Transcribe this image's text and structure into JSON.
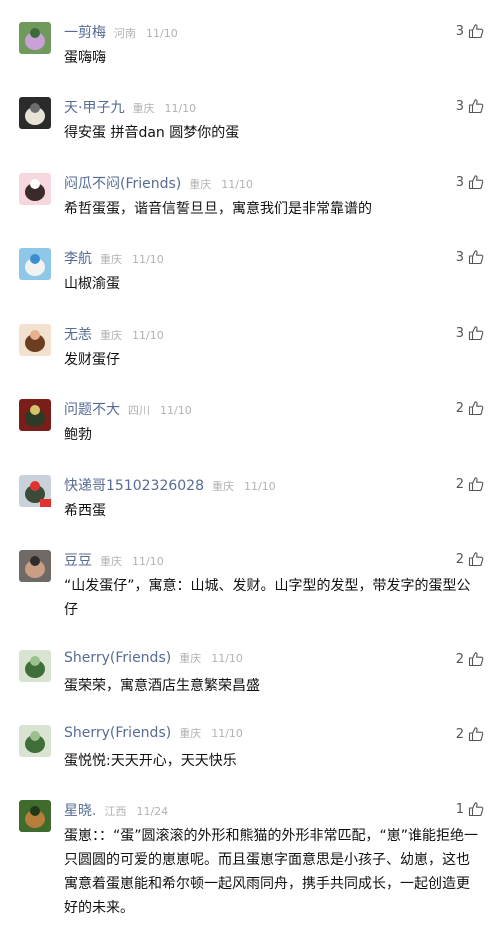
{
  "comments": [
    {
      "name": "一剪梅",
      "location": "河南",
      "date": "11/10",
      "likes": "3",
      "text": "蛋嗨嗨",
      "avatar": "avatar-garden",
      "colors": [
        "#6f9a5c",
        "#c9a1d6",
        "#3e6b3a"
      ]
    },
    {
      "name": "天·甲子九",
      "location": "重庆",
      "date": "11/10",
      "likes": "3",
      "text": "得安蛋 拼音dan 圆梦你的蛋",
      "avatar": "avatar-cats-dark",
      "colors": [
        "#2b2b2b",
        "#e8e2d8",
        "#6d6d6d"
      ]
    },
    {
      "name": "闷瓜不闷(Friends)",
      "location": "重庆",
      "date": "11/10",
      "likes": "3",
      "text": "希哲蛋蛋，谐音信誓旦旦，寓意我们是非常靠谱的",
      "avatar": "avatar-cartoon-girl",
      "colors": [
        "#f6d7dd",
        "#3b2a2a",
        "#ffffff"
      ]
    },
    {
      "name": "李航",
      "location": "重庆",
      "date": "11/10",
      "likes": "3",
      "text": "山椒渝蛋",
      "avatar": "avatar-white-bunny",
      "colors": [
        "#8fc7e8",
        "#f2f2f2",
        "#3a8fd0"
      ]
    },
    {
      "name": "无恙",
      "location": "重庆",
      "date": "11/10",
      "likes": "3",
      "text": "发财蛋仔",
      "avatar": "avatar-child-portrait",
      "colors": [
        "#f2e1cf",
        "#6a3e1f",
        "#e8b08f"
      ]
    },
    {
      "name": "问题不大",
      "location": "四川",
      "date": "11/10",
      "likes": "2",
      "text": "鲍勃",
      "avatar": "avatar-dark-character",
      "colors": [
        "#7a1e1a",
        "#2c3b25",
        "#d8c36a"
      ]
    },
    {
      "name": "快递哥15102326028",
      "location": "重庆",
      "date": "11/10",
      "likes": "2",
      "text": "希西蛋",
      "avatar": "avatar-landscape-flag",
      "colors": [
        "#c9d2da",
        "#3c4a3a",
        "#e0332f"
      ]
    },
    {
      "name": "豆豆",
      "location": "重庆",
      "date": "11/10",
      "likes": "2",
      "text": "“山发蛋仔”，寓意：山城、发财。山字型的发型，带发字的蛋型公仔",
      "avatar": "avatar-man-photo",
      "colors": [
        "#6f6a66",
        "#c89f85",
        "#2d2d2d"
      ]
    },
    {
      "name": "Sherry(Friends)",
      "location": "重庆",
      "date": "11/10",
      "likes": "2",
      "text": "蛋荣荣，寓意酒店生意繁荣昌盛",
      "avatar": "avatar-green-plant",
      "colors": [
        "#d8e3d1",
        "#3f6e38",
        "#9bbf8d"
      ]
    },
    {
      "name": "Sherry(Friends)",
      "location": "重庆",
      "date": "11/10",
      "likes": "2",
      "text": "蛋悦悦:天天开心，天天快乐",
      "avatar": "avatar-green-plant",
      "colors": [
        "#d8e3d1",
        "#3f6e38",
        "#9bbf8d"
      ]
    },
    {
      "name": "星晓.",
      "location": "江西",
      "date": "11/24",
      "likes": "1",
      "text": "蛋崽：：“蛋”圆滚滚的外形和熊猫的外形非常匹配，“崽”谁能拒绝一只圆圆的可爱的崽崽呢。而且蛋崽字面意思是小孩子、幼崽，这也寓意着蛋崽能和希尔顿一起风雨同舟，携手共同成长，一起创造更好的未来。",
      "avatar": "avatar-figurine",
      "colors": [
        "#3f6b2d",
        "#b77d3a",
        "#1f3a14"
      ]
    }
  ],
  "icons": {
    "like": "thumbs-up-icon",
    "flag": "flag-icon"
  },
  "colors": {
    "name": "#576b95",
    "meta": "#b2b2b2",
    "text": "#111111",
    "count": "#555555"
  }
}
